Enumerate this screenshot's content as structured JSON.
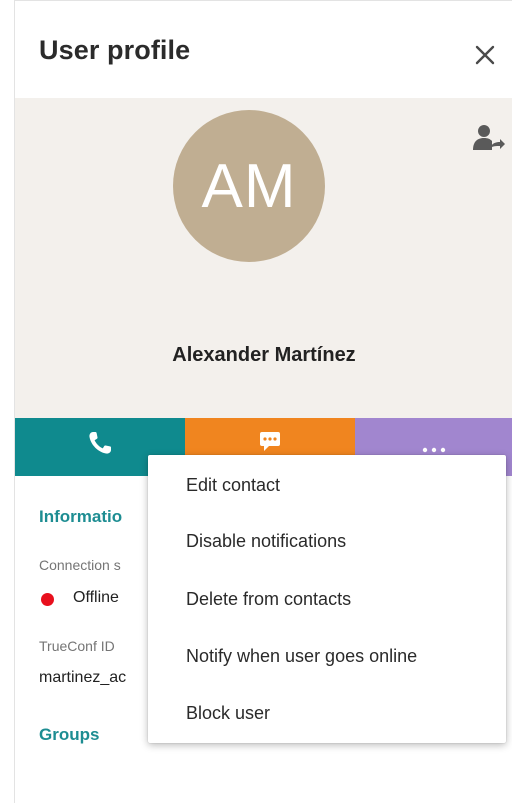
{
  "header": {
    "title": "User profile"
  },
  "icons": {
    "close": "close-icon",
    "share_contact": "user-share-icon",
    "call": "phone-icon",
    "chat": "chat-icon",
    "more": "more-icon"
  },
  "colors": {
    "avatar_bg": "#c0ae92",
    "call": "#0f8a8e",
    "chat": "#f0851f",
    "more": "#a186cf",
    "accent": "#1d8d92",
    "offline": "#e8101d"
  },
  "profile": {
    "initials": "AM",
    "name": "Alexander Martínez"
  },
  "info": {
    "section_title": "Informatio",
    "connection_label": "Connection s",
    "status": "Offline",
    "trueconf_label": "TrueConf ID",
    "trueconf_id": "martinez_ac"
  },
  "groups": {
    "section_title": "Groups"
  },
  "menu": {
    "items": [
      {
        "label": "Edit contact"
      },
      {
        "label": "Disable notifications"
      },
      {
        "label": "Delete from contacts"
      },
      {
        "label": "Notify when user goes online"
      },
      {
        "label": "Block user"
      }
    ]
  }
}
